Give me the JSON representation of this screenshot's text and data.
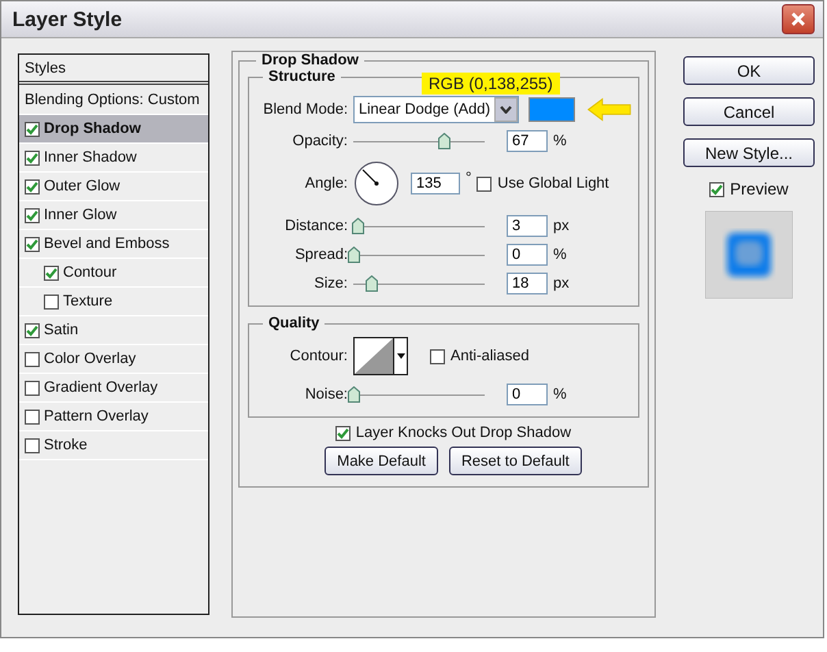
{
  "window": {
    "title": "Layer Style"
  },
  "styles_list": {
    "header": "Styles",
    "blending_options": "Blending Options: Custom",
    "effects": [
      {
        "label": "Drop Shadow",
        "checked": true,
        "selected": true
      },
      {
        "label": "Inner Shadow",
        "checked": true,
        "selected": false
      },
      {
        "label": "Outer Glow",
        "checked": true,
        "selected": false
      },
      {
        "label": "Inner Glow",
        "checked": true,
        "selected": false
      },
      {
        "label": "Bevel and Emboss",
        "checked": true,
        "selected": false,
        "children": [
          {
            "label": "Contour",
            "checked": true,
            "selected": false
          },
          {
            "label": "Texture",
            "checked": false,
            "selected": false
          }
        ]
      },
      {
        "label": "Satin",
        "checked": true,
        "selected": false
      },
      {
        "label": "Color Overlay",
        "checked": false,
        "selected": false
      },
      {
        "label": "Gradient Overlay",
        "checked": false,
        "selected": false
      },
      {
        "label": "Pattern Overlay",
        "checked": false,
        "selected": false
      },
      {
        "label": "Stroke",
        "checked": false,
        "selected": false
      }
    ]
  },
  "drop_shadow": {
    "title": "Drop Shadow",
    "structure": {
      "title": "Structure",
      "annotation": "RGB (0,138,255)",
      "rows": [
        {
          "kind": "dropdown",
          "label": "Blend Mode:",
          "value": "Linear Dodge (Add)",
          "color": "#008aff"
        },
        {
          "kind": "slider",
          "label": "Opacity:",
          "level": 0.69,
          "value": "67",
          "unit": "%"
        },
        {
          "kind": "angle",
          "label": "Angle:",
          "value": "135",
          "unit": "°",
          "option": {
            "label": "Use Global Light",
            "checked": false
          }
        },
        {
          "kind": "slider",
          "label": "Distance:",
          "level": 0.03,
          "value": "3",
          "unit": "px"
        },
        {
          "kind": "slider",
          "label": "Spread:",
          "level": 0,
          "value": "0",
          "unit": "%"
        },
        {
          "kind": "slider",
          "label": "Size:",
          "level": 0.14,
          "value": "18",
          "unit": "px"
        }
      ]
    },
    "quality": {
      "title": "Quality",
      "contour": {
        "label": "Contour:",
        "anti_aliased": {
          "label": "Anti-aliased",
          "checked": false
        }
      },
      "noise": {
        "label": "Noise:",
        "level": 0,
        "value": "0",
        "unit": "%"
      }
    },
    "knockout": {
      "label": "Layer Knocks Out Drop Shadow",
      "checked": true
    },
    "buttons": [
      "Make Default",
      "Reset to Default"
    ]
  },
  "actions": [
    "OK",
    "Cancel",
    "New Style..."
  ],
  "preview": {
    "label": "Preview",
    "checked": true
  }
}
